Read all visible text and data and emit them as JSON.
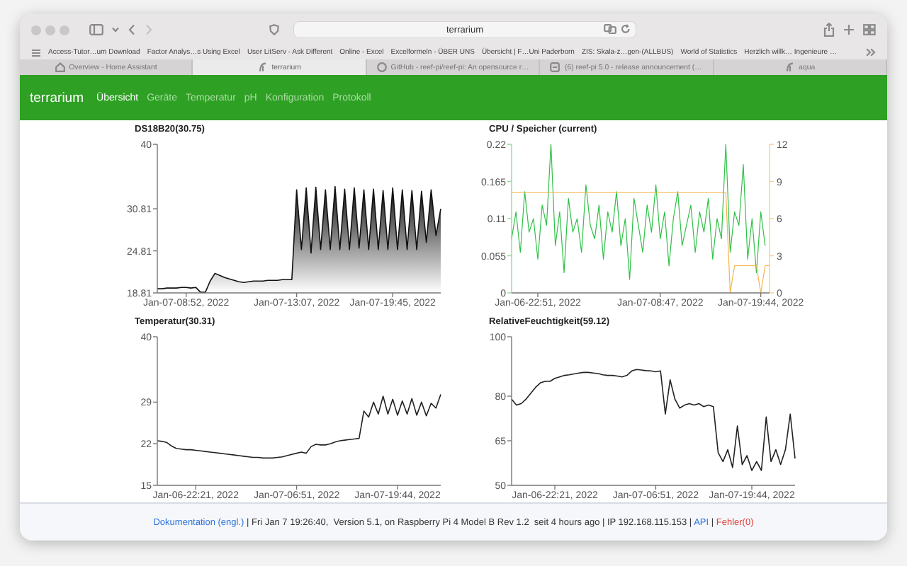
{
  "window": {
    "address": "terrarium"
  },
  "bookmarks": [
    "Access-Tutor…um Download",
    "Factor Analys…s Using Excel",
    "User LitServ - Ask Different",
    "Online - Excel",
    "Excelformeln - ÜBER UNS",
    "Übersicht | F…Uni Paderborn",
    "ZIS: Skala-z…gen-(ALLBUS)",
    "World of Statistics",
    "Herzlich willk… Ingenieure …"
  ],
  "tabs": [
    {
      "label": "Overview - Home Assistant",
      "selected": false,
      "kind": "home"
    },
    {
      "label": "terrarium",
      "selected": true,
      "kind": "logo"
    },
    {
      "label": "GitHub - reef-pi/reef-pi: An opensource r…",
      "selected": false,
      "kind": "github"
    },
    {
      "label": "(6) reef-pi 5.0 - release announcement (…",
      "selected": false,
      "kind": "forum"
    },
    {
      "label": "aqua",
      "selected": false,
      "kind": "logo"
    }
  ],
  "navbar": {
    "brand": "terrarium",
    "items": [
      {
        "label": "Übersicht",
        "selected": true
      },
      {
        "label": "Geräte",
        "selected": false
      },
      {
        "label": "Temperatur",
        "selected": false
      },
      {
        "label": "pH",
        "selected": false
      },
      {
        "label": "Konfiguration",
        "selected": false
      },
      {
        "label": "Protokoll",
        "selected": false
      }
    ]
  },
  "charts": [
    {
      "chart_data": {
        "type": "area",
        "title": "DS18B20(30.75)",
        "categories": [
          null,
          null,
          null,
          null,
          null,
          null,
          "Jan-07-08:52, 2022",
          null,
          null,
          null,
          null,
          null,
          null,
          null,
          null,
          null,
          null,
          null,
          null,
          null,
          null,
          null,
          null,
          null,
          null,
          null,
          null,
          null,
          null,
          "Jan-07-13:07, 2022",
          null,
          null,
          null,
          null,
          null,
          null,
          null,
          null,
          null,
          null,
          null,
          null,
          null,
          null,
          null,
          null,
          null,
          null,
          null,
          "Jan-07-19:45, 2022",
          null,
          null,
          null,
          null,
          null,
          null,
          null,
          null,
          null,
          null
        ],
        "ylim": [
          18.81,
          40
        ],
        "yticks": [
          18.81,
          24.81,
          30.81,
          40
        ],
        "series": [
          {
            "color": "#111111",
            "values": [
              19.4,
              19.4,
              19.5,
              19.5,
              19.5,
              19.6,
              19.6,
              19.5,
              19.6,
              18.9,
              18.9,
              20.5,
              21.6,
              21.3,
              21.0,
              20.8,
              20.6,
              20.4,
              20.3,
              20.4,
              20.5,
              20.5,
              20.5,
              20.6,
              20.6,
              20.6,
              20.7,
              20.7,
              20.7,
              33.5,
              25,
              33.8,
              24.5,
              33.9,
              25,
              33.5,
              25,
              34,
              25,
              33.6,
              25,
              33.8,
              25.2,
              33.5,
              25,
              33.6,
              25,
              33.4,
              25,
              33.8,
              25,
              33.5,
              25,
              33.4,
              25,
              33.3,
              26,
              33.5,
              27,
              30.8
            ]
          }
        ]
      }
    },
    {
      "chart_data": {
        "type": "line",
        "title": "CPU / Speicher (current)",
        "categories": [
          null,
          null,
          null,
          null,
          null,
          null,
          "Jan-06-22:51, 2022",
          null,
          null,
          null,
          null,
          null,
          null,
          null,
          null,
          null,
          null,
          null,
          null,
          null,
          null,
          null,
          null,
          null,
          null,
          null,
          null,
          null,
          null,
          null,
          null,
          null,
          null,
          null,
          "Jan-07-08:47, 2022",
          null,
          null,
          null,
          null,
          null,
          null,
          null,
          null,
          null,
          null,
          null,
          null,
          null,
          null,
          null,
          null,
          null,
          null,
          null,
          null,
          null,
          null,
          "Jan-07-19:44, 2022",
          null,
          null
        ],
        "ylim": [
          0,
          0.22
        ],
        "yticks": [
          0,
          0.055,
          0.11,
          0.165,
          0.22
        ],
        "y2lim": [
          0,
          12
        ],
        "y2ticks": [
          0,
          3,
          6,
          9,
          12
        ],
        "series": [
          {
            "color": "#2fc046",
            "values": [
              0.08,
              0.12,
              0.06,
              0.15,
              0.09,
              0.11,
              0.05,
              0.13,
              0.1,
              0.22,
              0.07,
              0.12,
              0.03,
              0.14,
              0.09,
              0.11,
              0.06,
              0.16,
              0.1,
              0.08,
              0.13,
              0.05,
              0.12,
              0.09,
              0.15,
              0.07,
              0.11,
              0.02,
              0.14,
              0.1,
              0.06,
              0.13,
              0.09,
              0.16,
              0.08,
              0.12,
              0.04,
              0.11,
              0.15,
              0.07,
              0.1,
              0.13,
              0.06,
              0.12,
              0.09,
              0.14,
              0.05,
              0.11,
              0.08,
              0.22,
              0.06,
              0.12,
              0.1,
              0.19,
              0.05,
              0.11,
              0.03,
              0.12,
              0.07,
              null
            ]
          },
          {
            "color": "#f3b44c",
            "axis": "y2",
            "values": [
              8.1,
              8.1,
              8.1,
              8.1,
              8.1,
              8.1,
              8.1,
              8.1,
              8.1,
              8.1,
              8.1,
              8.1,
              8.1,
              8.1,
              8.1,
              8.1,
              8.1,
              8.1,
              8.1,
              8.1,
              8.1,
              8.1,
              8.1,
              8.1,
              8.1,
              8.1,
              8.1,
              8.1,
              8.1,
              8.1,
              8.1,
              8.1,
              8.1,
              8.1,
              8.1,
              8.1,
              8.1,
              8.1,
              8.1,
              8.1,
              8.1,
              8.1,
              8.1,
              8.1,
              8.1,
              8.1,
              8.1,
              8.1,
              8.1,
              8.1,
              0,
              2.2,
              2.2,
              2.2,
              2.2,
              2.2,
              2.2,
              0,
              2.2,
              2.2
            ]
          }
        ]
      }
    },
    {
      "chart_data": {
        "type": "line",
        "title": "Temperatur(30.31)",
        "categories": [
          null,
          null,
          null,
          null,
          null,
          null,
          null,
          null,
          "Jan-06-22:21, 2022",
          null,
          null,
          null,
          null,
          null,
          null,
          null,
          null,
          null,
          null,
          null,
          null,
          null,
          null,
          null,
          null,
          null,
          null,
          null,
          null,
          "Jan-07-06:51, 2022",
          null,
          null,
          null,
          null,
          null,
          null,
          null,
          null,
          null,
          null,
          null,
          null,
          null,
          null,
          null,
          null,
          null,
          null,
          null,
          null,
          "Jan-07-19:44, 2022",
          null,
          null,
          null,
          null,
          null,
          null,
          null,
          null,
          null
        ],
        "ylim": [
          15,
          40
        ],
        "yticks": [
          15,
          22,
          29,
          40
        ],
        "series": [
          {
            "color": "#222222",
            "values": [
              22.5,
              22.4,
              22.2,
              21.6,
              21.2,
              21.1,
              21.0,
              21.0,
              20.9,
              20.8,
              20.7,
              20.6,
              20.5,
              20.4,
              20.3,
              20.2,
              20.1,
              20.0,
              19.9,
              19.8,
              19.7,
              19.7,
              19.6,
              19.6,
              19.6,
              19.7,
              19.8,
              20.0,
              20.2,
              20.4,
              20.6,
              20.4,
              21.5,
              21.9,
              21.8,
              21.8,
              22.0,
              22.3,
              22.5,
              22.6,
              22.7,
              22.8,
              22.9,
              27.5,
              26.5,
              29,
              27,
              30,
              27,
              29.5,
              26.8,
              29.2,
              27,
              29.6,
              26.8,
              29,
              26.7,
              28.8,
              28,
              30.3
            ]
          }
        ]
      }
    },
    {
      "chart_data": {
        "type": "line",
        "title": "RelativeFeuchtigkeit(59.12)",
        "categories": [
          null,
          null,
          null,
          null,
          null,
          null,
          null,
          null,
          null,
          "Jan-06-22:21, 2022",
          null,
          null,
          null,
          null,
          null,
          null,
          null,
          null,
          null,
          null,
          null,
          null,
          null,
          null,
          null,
          null,
          null,
          null,
          null,
          null,
          "Jan-07-06:51, 2022",
          null,
          null,
          null,
          null,
          null,
          null,
          null,
          null,
          null,
          null,
          null,
          null,
          null,
          null,
          null,
          null,
          null,
          null,
          null,
          "Jan-07-19:44, 2022",
          null,
          null,
          null,
          null,
          null,
          null,
          null,
          null,
          null
        ],
        "ylim": [
          50,
          100
        ],
        "yticks": [
          50,
          65,
          80,
          100
        ],
        "series": [
          {
            "color": "#222222",
            "values": [
              79,
              77,
              77.5,
              79,
              81,
              83,
              84.5,
              85,
              85,
              86,
              86.5,
              87,
              87.2,
              87.5,
              87.8,
              88,
              88,
              87.8,
              87.6,
              87.2,
              87,
              87,
              86.8,
              86.5,
              87,
              88.5,
              89,
              88.8,
              88.6,
              88.5,
              88.2,
              88.5,
              74,
              85.5,
              79,
              76,
              77,
              77.5,
              77,
              77.5,
              76.5,
              77,
              76.5,
              61,
              58,
              62,
              56,
              70,
              57,
              60,
              55,
              58,
              55,
              73,
              58,
              62,
              57,
              62,
              74,
              59
            ]
          }
        ]
      }
    }
  ],
  "footer": {
    "doc_link": "Dokumentation (engl.)",
    "info": " | Fri Jan 7 19:26:40,  Version 5.1, on Raspberry Pi 4 Model B Rev 1.2  seit 4 hours ago | IP 192.168.115.153 | ",
    "api_link": "API",
    "separator": " | ",
    "error_link": "Fehler(0)"
  }
}
